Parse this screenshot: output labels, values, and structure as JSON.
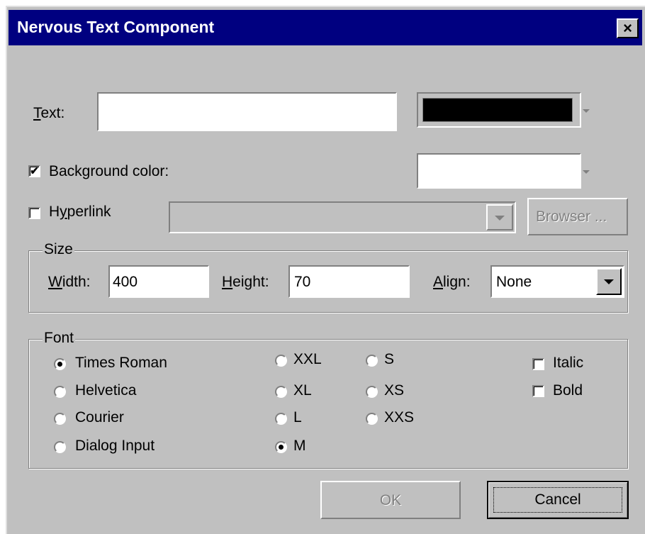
{
  "window": {
    "title": "Nervous Text Component",
    "close_label": "×"
  },
  "text_row": {
    "label_accel": "T",
    "label_rest": "ext:",
    "value": "",
    "color": "#000000"
  },
  "background": {
    "label": "Background color:",
    "checked": true,
    "color": "#ffffff",
    "check_mark": "✔"
  },
  "hyperlink": {
    "label_pre": "H",
    "label_accel": "y",
    "label_rest": "perlink",
    "checked": false,
    "value": "",
    "browse_label": "Browser ..."
  },
  "size": {
    "legend": "Size",
    "width_accel": "W",
    "width_rest": "idth:",
    "width_value": "400",
    "height_accel": "H",
    "height_rest": "eight:",
    "height_value": "70",
    "align_accel": "A",
    "align_rest": "lign:",
    "align_value": "None"
  },
  "font": {
    "legend": "Font",
    "families": [
      "Times Roman",
      "Helvetica",
      "Courier",
      "Dialog Input"
    ],
    "selected_family": "Times Roman",
    "sizes_col1": [
      "XXL",
      "XL",
      "L",
      "M"
    ],
    "sizes_col2": [
      "S",
      "XS",
      "XXS"
    ],
    "selected_size": "M",
    "italic_label": "Italic",
    "italic_checked": false,
    "bold_label": "Bold",
    "bold_checked": false
  },
  "buttons": {
    "ok_label": "OK",
    "cancel_label": "Cancel"
  }
}
